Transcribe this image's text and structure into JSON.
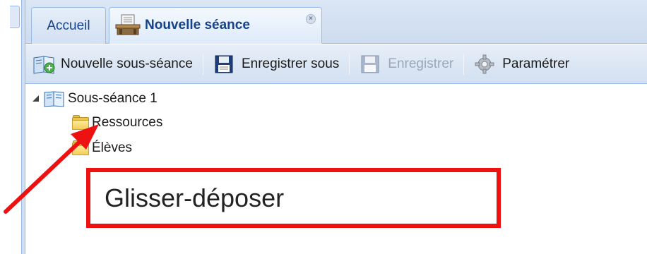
{
  "tabs": [
    {
      "label": "Accueil",
      "active": false,
      "closable": false
    },
    {
      "label": "Nouvelle séance",
      "active": true,
      "closable": true
    }
  ],
  "toolbar": {
    "new_subsession": "Nouvelle sous-séance",
    "save_as": "Enregistrer sous",
    "save": "Enregistrer",
    "save_disabled": true,
    "configure": "Paramétrer"
  },
  "tree": {
    "root": {
      "label": "Sous-séance 1",
      "expanded": true,
      "icon": "book-icon"
    },
    "children": [
      {
        "label": "Ressources",
        "icon": "folder-icon"
      },
      {
        "label": "Élèves",
        "icon": "folder-icon"
      }
    ]
  },
  "annotation": {
    "callout_text": "Glisser-déposer",
    "color": "#ee1111"
  },
  "colors": {
    "accent": "#15428b",
    "border": "#99bbe8",
    "folder": "#f3cf57"
  }
}
